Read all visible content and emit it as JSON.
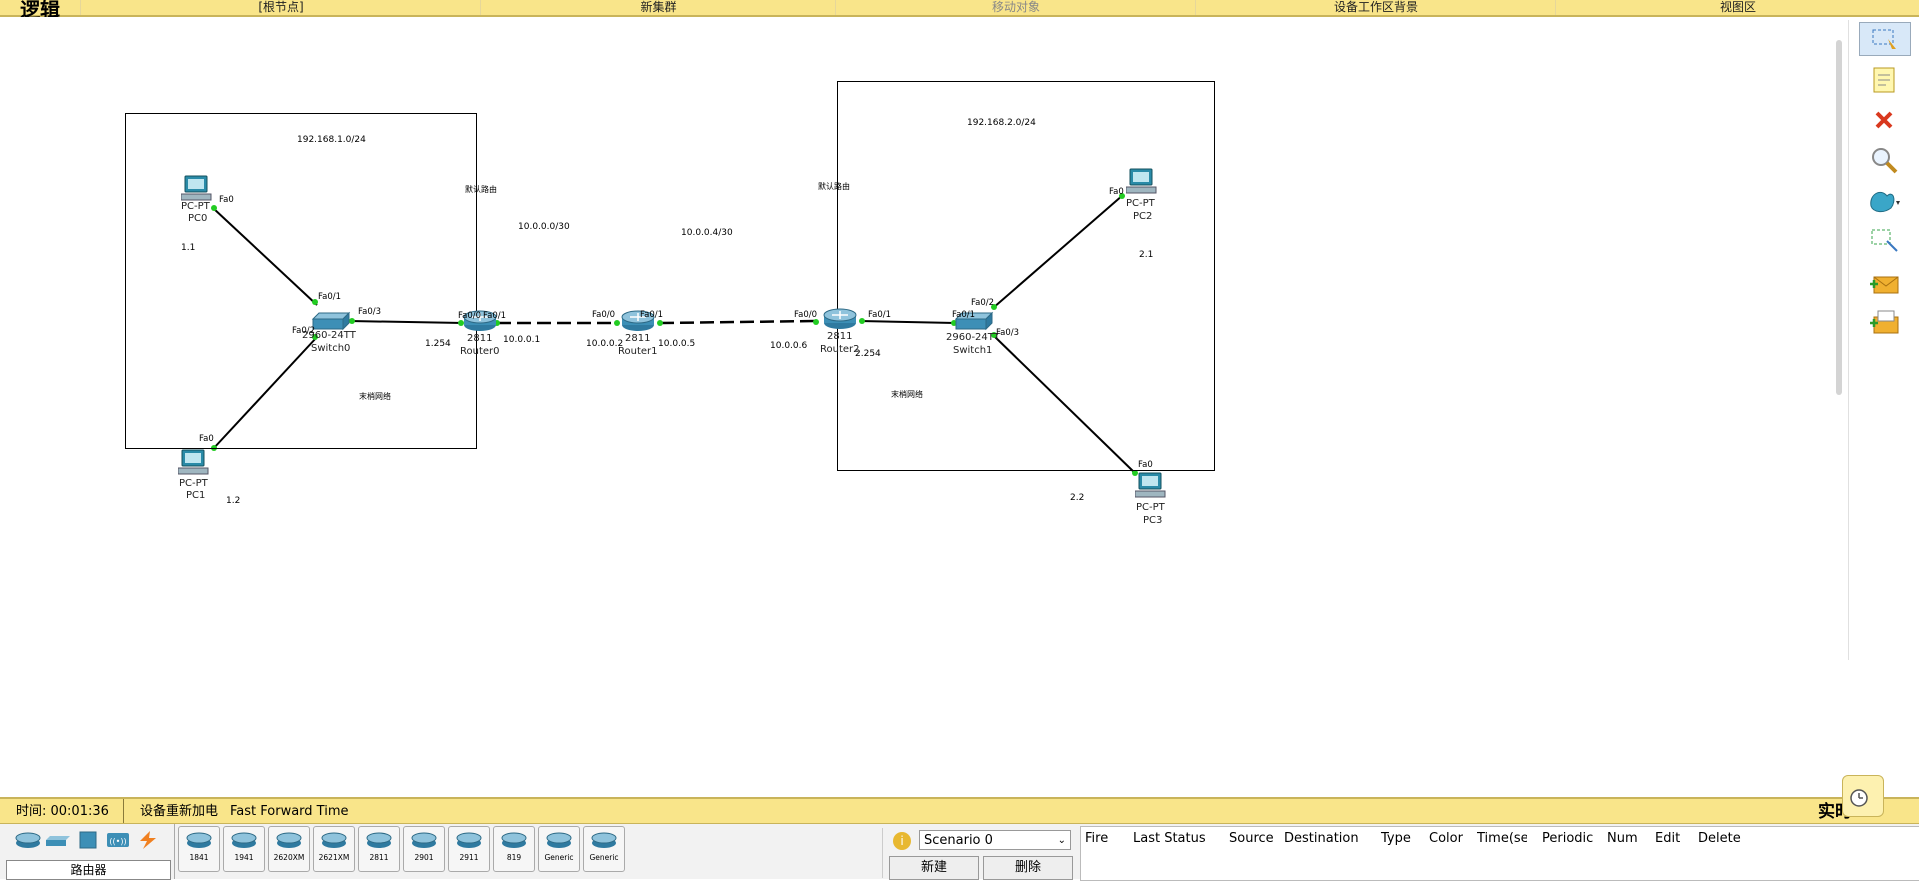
{
  "topbar": {
    "mode_label": "逻辑",
    "root_label": "[根节点]",
    "new_cluster": "新集群",
    "move_object": "移动对象",
    "workspace_bg": "设备工作区背景",
    "viewport": "视图区"
  },
  "clusters": {
    "left": {
      "subnet": "192.168.1.0/24",
      "default_route": "默认路由",
      "stub": "末梢网络"
    },
    "right": {
      "subnet": "192.168.2.0/24",
      "default_route": "默认路由",
      "stub": "末梢网络"
    }
  },
  "wan": {
    "net1": "10.0.0.0/30",
    "net2": "10.0.0.4/30"
  },
  "devices": {
    "pc0": {
      "type": "PC-PT",
      "name": "PC0",
      "port": "Fa0",
      "addr": "1.1"
    },
    "pc1": {
      "type": "PC-PT",
      "name": "PC1",
      "port": "Fa0",
      "addr": "1.2"
    },
    "pc2": {
      "type": "PC-PT",
      "name": "PC2",
      "port": "Fa0",
      "addr": "2.1"
    },
    "pc3": {
      "type": "PC-PT",
      "name": "PC3",
      "port": "Fa0",
      "addr": "2.2"
    },
    "switch0": {
      "model": "2960-24TT",
      "name": "Switch0",
      "p1": "Fa0/1",
      "p2": "Fa0/2",
      "p3": "Fa0/3"
    },
    "switch1": {
      "model": "2960-24TT",
      "name": "Switch1",
      "p1": "Fa0/1",
      "p2": "Fa0/2",
      "p3": "Fa0/3"
    },
    "router0": {
      "model": "2811",
      "name": "Router0",
      "p0": "Fa0/0",
      "p1": "Fa0/1",
      "lan": "1.254",
      "wan": "10.0.0.1"
    },
    "router1": {
      "model": "2811",
      "name": "Router1",
      "p0": "Fa0/0",
      "p1": "Fa0/1",
      "wan0": "10.0.0.2",
      "wan1": "10.0.0.5"
    },
    "router2": {
      "model": "2811",
      "name": "Router2",
      "p0": "Fa0/0",
      "p1": "Fa0/1",
      "lan": "2.254",
      "wan": "10.0.0.6"
    }
  },
  "status": {
    "time_label": "时间: 00:01:36",
    "power_cycle": "设备重新加电",
    "fast_forward": "Fast Forward Time",
    "realtime": "实时"
  },
  "bottom": {
    "category_label": "路由器",
    "models": [
      "1841",
      "1941",
      "2620XM",
      "2621XM",
      "2811",
      "2901",
      "2911",
      "819",
      "Generic",
      "Generic"
    ],
    "scenario": "Scenario 0",
    "new_btn": "新建",
    "delete_btn": "删除",
    "pdu_headers": [
      "Fire",
      "Last Status",
      "Source",
      "Destination",
      "Type",
      "Color",
      "Time(sec)",
      "Periodic",
      "Num",
      "Edit",
      "Delete"
    ]
  },
  "colors": {
    "accent": "#f9e58a",
    "link_up": "#22cc22"
  }
}
